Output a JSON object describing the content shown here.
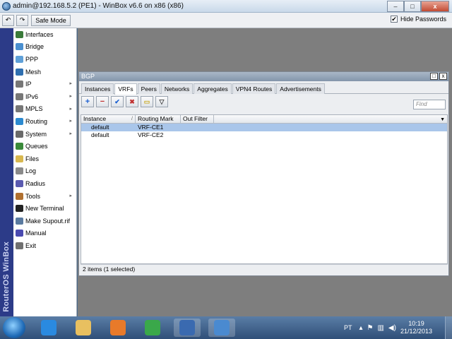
{
  "window": {
    "title": "admin@192.168.5.2 (PE1) - WinBox v6.6 on x86 (x86)",
    "min": "–",
    "max": "□",
    "close": "x"
  },
  "toolbar": {
    "undo": "↶",
    "redo": "↷",
    "safe_mode": "Safe Mode",
    "hide_passwords": "Hide Passwords",
    "hide_passwords_checked": "✔"
  },
  "sidebar": {
    "brand": "RouterOS WinBox",
    "items": [
      {
        "label": "Interfaces",
        "color": "#3a7a3a",
        "arrow": ""
      },
      {
        "label": "Bridge",
        "color": "#4a8fd0",
        "arrow": ""
      },
      {
        "label": "PPP",
        "color": "#5fa0d8",
        "arrow": ""
      },
      {
        "label": "Mesh",
        "color": "#2f6fb0",
        "arrow": ""
      },
      {
        "label": "IP",
        "color": "#777777",
        "arrow": "▸"
      },
      {
        "label": "IPv6",
        "color": "#777777",
        "arrow": "▸"
      },
      {
        "label": "MPLS",
        "color": "#777777",
        "arrow": "▸"
      },
      {
        "label": "Routing",
        "color": "#2c8ad0",
        "arrow": "▸"
      },
      {
        "label": "System",
        "color": "#6a6a6a",
        "arrow": "▸"
      },
      {
        "label": "Queues",
        "color": "#3a8a3a",
        "arrow": ""
      },
      {
        "label": "Files",
        "color": "#d8b850",
        "arrow": ""
      },
      {
        "label": "Log",
        "color": "#8a8a8a",
        "arrow": ""
      },
      {
        "label": "Radius",
        "color": "#5a5ab0",
        "arrow": ""
      },
      {
        "label": "Tools",
        "color": "#b07030",
        "arrow": "▸"
      },
      {
        "label": "New Terminal",
        "color": "#222222",
        "arrow": ""
      },
      {
        "label": "Make Supout.rif",
        "color": "#5a7aa0",
        "arrow": ""
      },
      {
        "label": "Manual",
        "color": "#4a4ab0",
        "arrow": ""
      },
      {
        "label": "Exit",
        "color": "#707070",
        "arrow": ""
      }
    ]
  },
  "bgp": {
    "title": "BGP",
    "tabs": [
      {
        "label": "Instances",
        "active": false
      },
      {
        "label": "VRFs",
        "active": true
      },
      {
        "label": "Peers",
        "active": false
      },
      {
        "label": "Networks",
        "active": false
      },
      {
        "label": "Aggregates",
        "active": false
      },
      {
        "label": "VPN4 Routes",
        "active": false
      },
      {
        "label": "Advertisements",
        "active": false
      }
    ],
    "actions": {
      "add": "+",
      "remove": "−",
      "enable": "✔",
      "disable": "✖",
      "comment": "▭",
      "filter": "▽"
    },
    "find_placeholder": "Find",
    "columns": {
      "instance": "Instance",
      "routing_mark": "Routing Mark",
      "out_filter": "Out Filter"
    },
    "rows": [
      {
        "instance": "default",
        "routing_mark": "VRF-CE1",
        "out_filter": "",
        "selected": true
      },
      {
        "instance": "default",
        "routing_mark": "VRF-CE2",
        "out_filter": "",
        "selected": false
      }
    ],
    "status": "2 items (1 selected)"
  },
  "taskbar": {
    "lang": "PT",
    "time": "10:19",
    "date": "21/12/2013",
    "apps": [
      {
        "name": "internet-explorer",
        "color": "#2a8ae0"
      },
      {
        "name": "file-explorer",
        "color": "#e8c060"
      },
      {
        "name": "media-player",
        "color": "#e87a2a"
      },
      {
        "name": "chrome",
        "color": "#3aa84a"
      },
      {
        "name": "winbox",
        "color": "#3a6ab0"
      },
      {
        "name": "winbox-window",
        "color": "#4a8ad0"
      }
    ]
  }
}
